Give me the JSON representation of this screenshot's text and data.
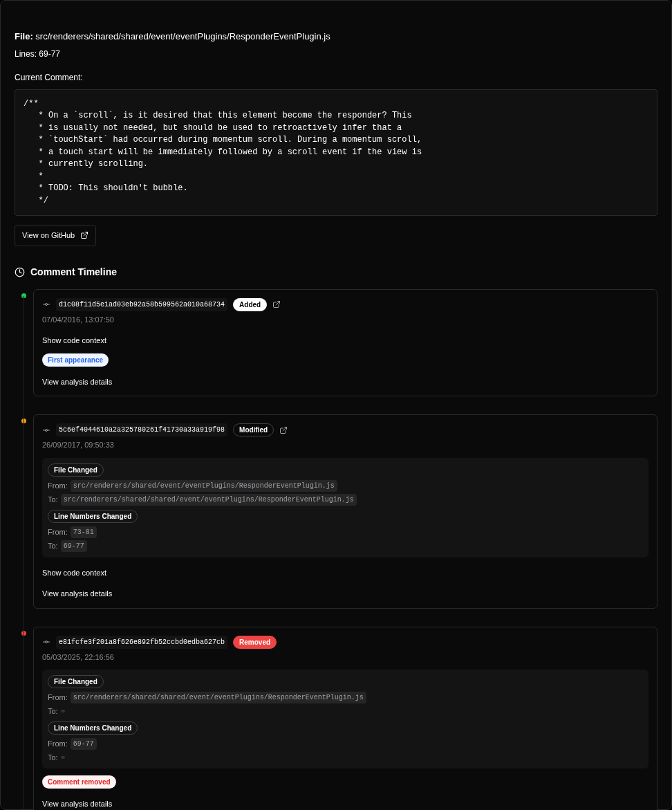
{
  "file": {
    "label": "File:",
    "path": "src/renderers/shared/shared/event/eventPlugins/ResponderEventPlugin.js"
  },
  "lines": "Lines: 69-77",
  "current_comment": {
    "label": "Current Comment:",
    "code": [
      "/**",
      "   * On a `scroll`, is it desired that this element become the responder? This",
      "   * is usually not needed, but should be used to retroactively infer that a",
      "   * `touchStart` had occurred during momentum scroll. During a momentum scroll,",
      "   * a touch start will be immediately followed by a scroll event if the view is",
      "   * currently scrolling.",
      "   *",
      "   * TODO: This shouldn't bubble.",
      "   */"
    ]
  },
  "github_button": "View on GitHub",
  "timeline": {
    "title": "Comment Timeline",
    "entries": [
      {
        "kind": "added",
        "hash": "d1c08f11d5e1ad03eb92a58b599562a010a68734",
        "badge": "Added",
        "external_link": true,
        "date": "07/04/2016, 13:07:50",
        "code_context": "Show code context",
        "tag": {
          "kind": "info",
          "text": "First appearance"
        },
        "details": "View analysis details"
      },
      {
        "kind": "modified",
        "hash": "5c6ef4044610a2a325780261f41730a33a919f98",
        "badge": "Modified",
        "external_link": true,
        "date": "26/09/2017, 09:50:33",
        "changes": [
          {
            "title": "File Changed",
            "from_label": "From:",
            "from": "src/renderers/shared/event/eventPlugins/ResponderEventPlugin.js",
            "to_label": "To:",
            "to": "src/renderers/shared/shared/event/eventPlugins/ResponderEventPlugin.js"
          },
          {
            "title": "Line Numbers Changed",
            "from_label": "From:",
            "from": "73-81",
            "to_label": "To:",
            "to": "69-77"
          }
        ],
        "code_context": "Show code context",
        "details": "View analysis details"
      },
      {
        "kind": "removed",
        "hash": "e81fcfe3f201a8f626e892fb52ccbd0edba627cb",
        "badge": "Removed",
        "external_link": false,
        "date": "05/03/2025, 22:16:56",
        "changes": [
          {
            "title": "File Changed",
            "from_label": "From:",
            "from": "src/renderers/shared/shared/event/eventPlugins/ResponderEventPlugin.js",
            "to_label": "To:"
          },
          {
            "title": "Line Numbers Changed",
            "from_label": "From:",
            "from": "69-77",
            "to_label": "To:"
          }
        ],
        "tag": {
          "kind": "danger",
          "text": "Comment removed"
        },
        "details": "View analysis details"
      }
    ]
  }
}
